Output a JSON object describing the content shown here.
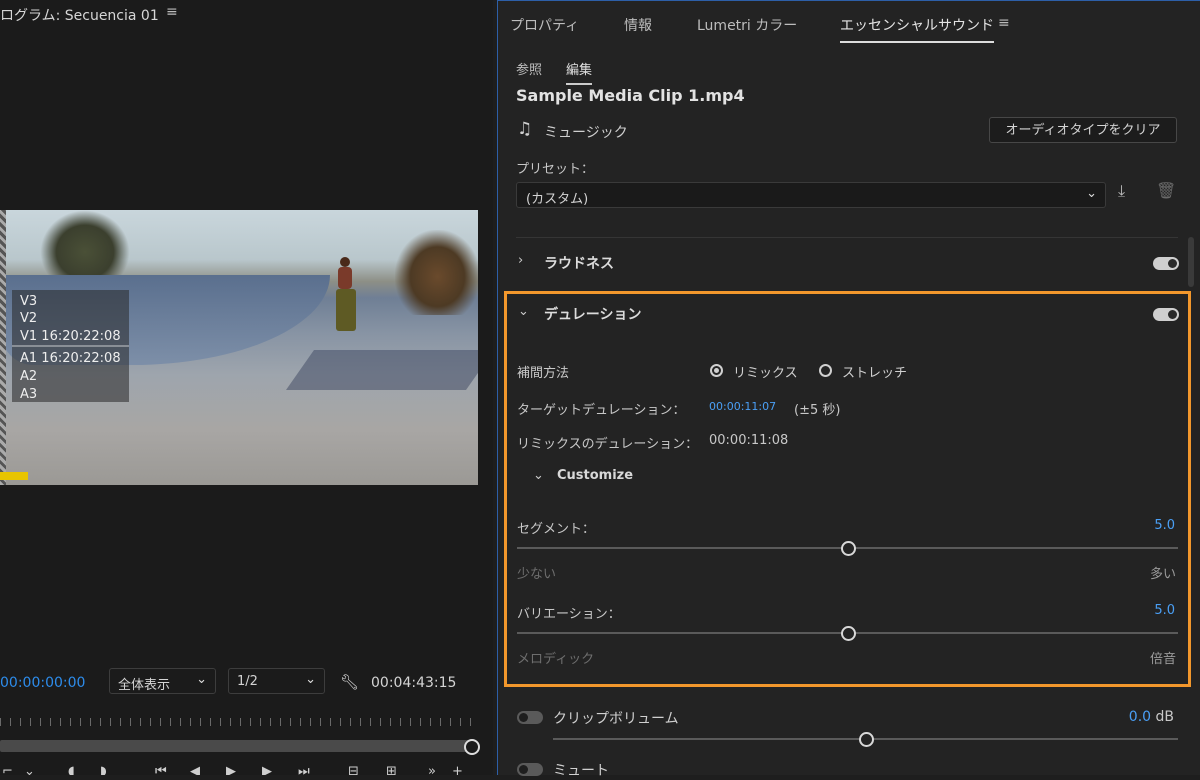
{
  "monitor": {
    "title": "ログラム: Secuencia 01",
    "overlay": {
      "v3": "V3",
      "v2": "V2",
      "v1": "V1 16:20:22:08",
      "a1": "A1 16:20:22:08",
      "a2": "A2",
      "a3": "A3"
    },
    "timecode": "00:00:00:00",
    "zoom": "全体表示",
    "resolution": "1/2",
    "duration": "00:04:43:15"
  },
  "panel": {
    "tabs": [
      "プロパティ",
      "情報",
      "Lumetri カラー",
      "エッセンシャルサウンド"
    ],
    "subtabs": [
      "参照",
      "編集"
    ],
    "clip_name": "Sample Media Clip 1.mp4",
    "audio_type": "ミュージック",
    "clear_button": "オーディオタイプをクリア",
    "preset_label": "プリセット：",
    "preset_value": "(カスタム)",
    "loudness": {
      "label": "ラウドネス",
      "enabled": true
    },
    "duration": {
      "label": "デュレーション",
      "enabled": true,
      "method_label": "補間方法",
      "method_options": [
        "リミックス",
        "ストレッチ"
      ],
      "method_selected": "リミックス",
      "target_label": "ターゲットデュレーション：",
      "target_value": "00:00:11:07",
      "target_range": "(±5 秒)",
      "remix_label": "リミックスのデュレーション：",
      "remix_value": "00:00:11:08",
      "customize_label": "Customize",
      "segments": {
        "label": "セグメント：",
        "value": "5.0",
        "min_label": "少ない",
        "max_label": "多い",
        "level": 0.5
      },
      "variation": {
        "label": "バリエーション：",
        "value": "5.0",
        "min_label": "メロディック",
        "max_label": "倍音",
        "level": 0.5
      }
    },
    "clip_volume": {
      "label": "クリップボリューム",
      "value": "0.0",
      "unit": "dB",
      "enabled": false,
      "level": 0.5
    },
    "mute": {
      "label": "ミュート",
      "enabled": false
    }
  },
  "colors": {
    "accent_blue": "#4a9ff5",
    "highlight_orange": "#f2972c",
    "timecode_blue": "#2d8ceb"
  }
}
